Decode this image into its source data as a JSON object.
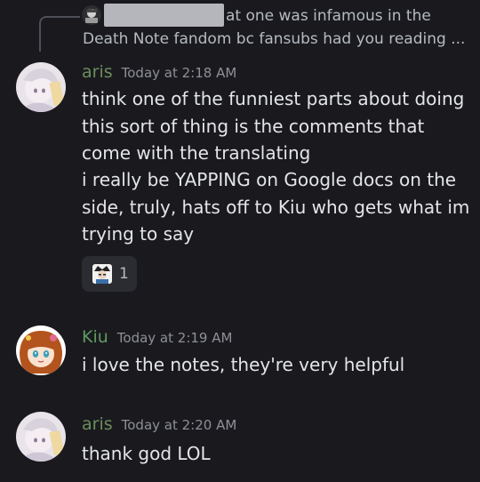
{
  "reply": {
    "line1": "at one was infamous in the",
    "line2": "Death Note fandom bc fansubs had you reading ..."
  },
  "messages": [
    {
      "author": "aris",
      "timestamp": "Today at 2:18 AM",
      "lines": [
        "think one of the funniest parts about doing",
        "this sort of thing is the comments that",
        "come with the translating",
        "i really be YAPPING on Google docs on the",
        "side, truly, hats off to Kiu who gets what im",
        "trying to say"
      ],
      "reaction": {
        "count": "1"
      }
    },
    {
      "author": "Kiu",
      "timestamp": "Today at 2:19 AM",
      "lines": [
        "i love the notes, they're very helpful"
      ]
    },
    {
      "author": "aris",
      "timestamp": "Today at 2:20 AM",
      "lines": [
        "thank god LOL"
      ]
    }
  ],
  "colors": {
    "background": "#1a1a1e",
    "aris_name": "#6b8e5d",
    "kiu_name": "#5f9a63",
    "timestamp": "#8d9096",
    "message_text": "#e3e5e8"
  }
}
